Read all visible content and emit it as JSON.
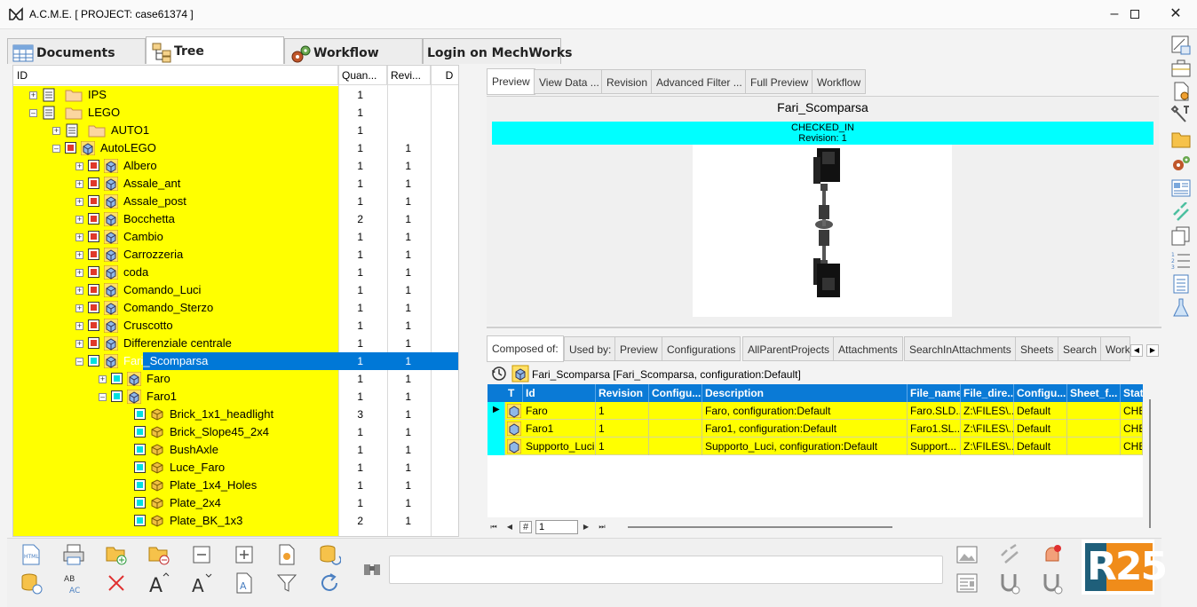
{
  "window": {
    "title": "A.C.M.E. [ PROJECT: case61374 ]"
  },
  "main_tabs": [
    {
      "label": "Documents",
      "icon": "table-icon"
    },
    {
      "label": "Tree",
      "icon": "hierarchy-icon"
    },
    {
      "label": "Workflow",
      "icon": "gears-icon"
    },
    {
      "label": "Login on MechWorks",
      "icon": ""
    }
  ],
  "tree": {
    "columns": [
      "ID",
      "Quan...",
      "Revi...",
      "D"
    ],
    "rows": [
      {
        "name": "IPS",
        "qty": "1",
        "rev": ""
      },
      {
        "name": "LEGO",
        "qty": "1",
        "rev": ""
      },
      {
        "name": "AUTO1",
        "qty": "1",
        "rev": ""
      },
      {
        "name": "AutoLEGO",
        "qty": "1",
        "rev": "1"
      },
      {
        "name": "Albero",
        "qty": "1",
        "rev": "1"
      },
      {
        "name": "Assale_ant",
        "qty": "1",
        "rev": "1"
      },
      {
        "name": "Assale_post",
        "qty": "1",
        "rev": "1"
      },
      {
        "name": "Bocchetta",
        "qty": "2",
        "rev": "1"
      },
      {
        "name": "Cambio",
        "qty": "1",
        "rev": "1"
      },
      {
        "name": "Carrozzeria",
        "qty": "1",
        "rev": "1"
      },
      {
        "name": "coda",
        "qty": "1",
        "rev": "1"
      },
      {
        "name": "Comando_Luci",
        "qty": "1",
        "rev": "1"
      },
      {
        "name": "Comando_Sterzo",
        "qty": "1",
        "rev": "1"
      },
      {
        "name": "Cruscotto",
        "qty": "1",
        "rev": "1"
      },
      {
        "name": "Differenziale centrale",
        "qty": "1",
        "rev": "1"
      },
      {
        "name": "Fari_Scomparsa",
        "qty": "1",
        "rev": "1"
      },
      {
        "name": "Faro",
        "qty": "1",
        "rev": "1"
      },
      {
        "name": "Faro1",
        "qty": "1",
        "rev": "1"
      },
      {
        "name": "Brick_1x1_headlight",
        "qty": "3",
        "rev": "1"
      },
      {
        "name": "Brick_Slope45_2x4",
        "qty": "1",
        "rev": "1"
      },
      {
        "name": "BushAxle",
        "qty": "1",
        "rev": "1"
      },
      {
        "name": "Luce_Faro",
        "qty": "1",
        "rev": "1"
      },
      {
        "name": "Plate_1x4_Holes",
        "qty": "1",
        "rev": "1"
      },
      {
        "name": "Plate_2x4",
        "qty": "1",
        "rev": "1"
      },
      {
        "name": "Plate_BK_1x3",
        "qty": "2",
        "rev": "1"
      }
    ],
    "colors": {
      "row_bg": "#ffff00",
      "selected": "#0078d7",
      "checked_out": "#e0382a",
      "checked_in": "#00e0e0"
    }
  },
  "preview_tabs": [
    "Preview",
    "View Data ...",
    "Revision",
    "Advanced Filter ...",
    "Full Preview",
    "Workflow"
  ],
  "preview": {
    "title": "Fari_Scomparsa",
    "status": "CHECKED_IN",
    "revision": "Revision: 1"
  },
  "detail_tabs": [
    "Composed of:",
    "Used by:",
    "Preview",
    "Configurations",
    "AllParentProjects",
    "Attachments",
    "SearchInAttachments",
    "Sheets",
    "Search",
    "Work"
  ],
  "breadcrumb": "Fari_Scomparsa [Fari_Scomparsa, configuration:Default]",
  "grid": {
    "columns": [
      "T",
      "Id",
      "Revision",
      "Configu...",
      "Description",
      "File_name",
      "File_dire...",
      "Configu...",
      "Sheet_f...",
      "Stat"
    ],
    "rows": [
      {
        "id": "Faro",
        "revision": "1",
        "config": "",
        "description": "Faro, configuration:Default",
        "file_name": "Faro.SLD...",
        "file_dir": "Z:\\FILES\\...",
        "config2": "Default",
        "sheet": "",
        "status": "CHE"
      },
      {
        "id": "Faro1",
        "revision": "1",
        "config": "",
        "description": "Faro1, configuration:Default",
        "file_name": "Faro1.SL...",
        "file_dir": "Z:\\FILES\\...",
        "config2": "Default",
        "sheet": "",
        "status": "CHE"
      },
      {
        "id": "Supporto_Luci",
        "revision": "1",
        "config": "",
        "description": "Supporto_Luci, configuration:Default",
        "file_name": "Support...",
        "file_dir": "Z:\\FILES\\...",
        "config2": "Default",
        "sheet": "",
        "status": "CHE"
      }
    ]
  },
  "pager": {
    "page": "1",
    "hash": "#"
  },
  "logo": {
    "text": "R25"
  },
  "search": {
    "placeholder": ""
  }
}
